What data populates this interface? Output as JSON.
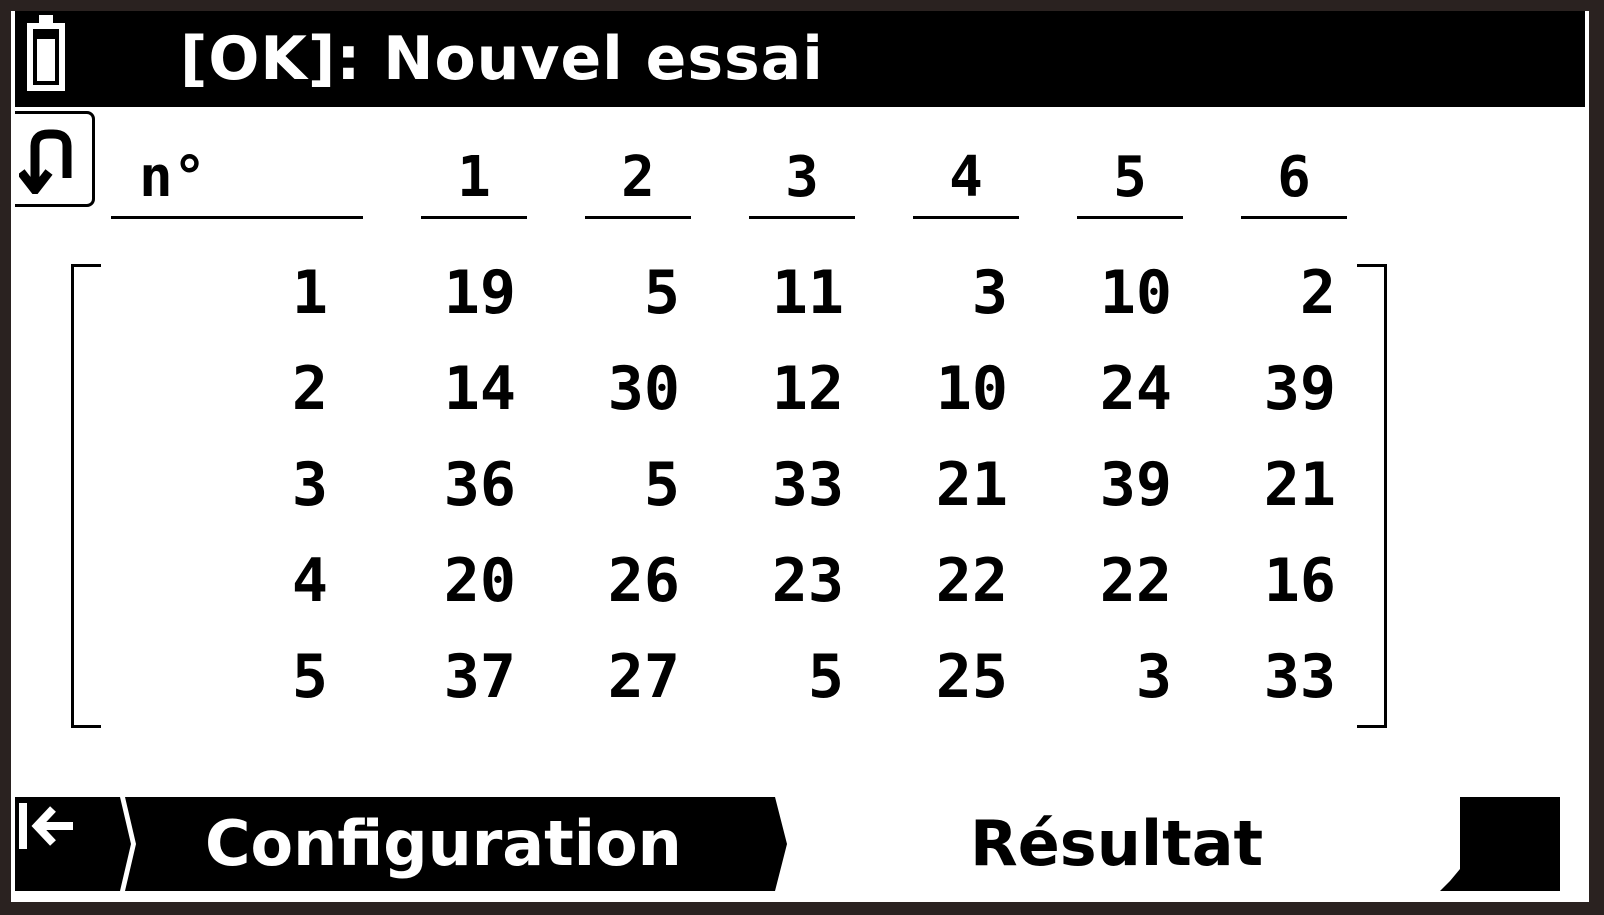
{
  "status_bar": {
    "title": "[OK]: Nouvel essai",
    "battery_icon": "battery-icon"
  },
  "back_icon": "return-arrow-icon",
  "table": {
    "header": [
      "n°",
      "1",
      "2",
      "3",
      "4",
      "5",
      "6"
    ],
    "rows": [
      [
        "1",
        "19",
        "5",
        "11",
        "3",
        "10",
        "2"
      ],
      [
        "2",
        "14",
        "30",
        "12",
        "10",
        "24",
        "39"
      ],
      [
        "3",
        "36",
        "5",
        "33",
        "21",
        "39",
        "21"
      ],
      [
        "4",
        "20",
        "26",
        "23",
        "22",
        "22",
        "16"
      ],
      [
        "5",
        "37",
        "27",
        "5",
        "25",
        "3",
        "33"
      ]
    ]
  },
  "softkeys": {
    "exit_icon": "exit-arrow-icon",
    "configuration_label": "Configuration",
    "result_label": "Résultat"
  },
  "colors": {
    "foreground": "#000000",
    "background": "#ffffff"
  }
}
